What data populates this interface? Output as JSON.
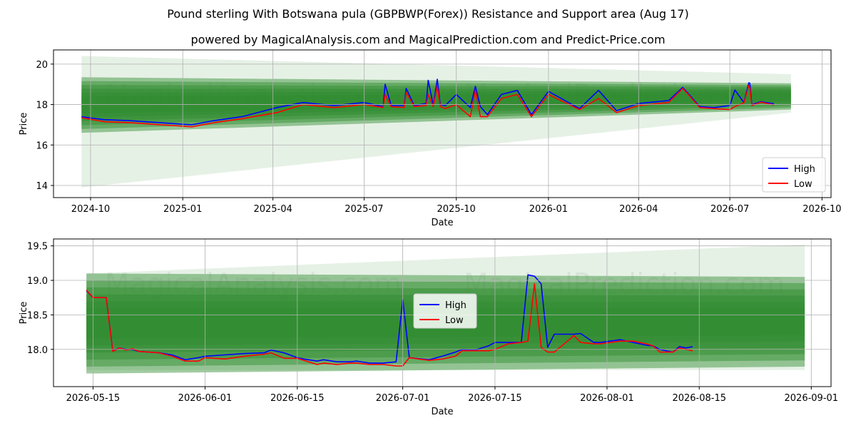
{
  "title": "Pound sterling With Botswana pula (GBPBWP(Forex)) Resistance and Support area (Aug 17)",
  "subtitle": "powered by MagicalAnalysis.com and MagicalPrediction.com and Predict-Price.com",
  "colors": {
    "high": "#0000ff",
    "low": "#ff0000",
    "band": "#2e8b2e",
    "grid": "#b0b0b0"
  },
  "chart_data": [
    {
      "type": "line",
      "xlabel": "Date",
      "ylabel": "Price",
      "xlim": [
        "2024-08-25",
        "2026-10-10"
      ],
      "ylim": [
        13.4,
        20.7
      ],
      "x_ticks": [
        "2024-10",
        "2025-01",
        "2025-04",
        "2025-07",
        "2025-10",
        "2026-01",
        "2026-04",
        "2026-07",
        "2026-10"
      ],
      "x_tick_dates": [
        "2024-10-01",
        "2025-01-01",
        "2025-04-01",
        "2025-07-01",
        "2025-10-01",
        "2026-01-01",
        "2026-04-01",
        "2026-07-01",
        "2026-10-01"
      ],
      "y_ticks": [
        "14",
        "16",
        "18",
        "20"
      ],
      "y_tick_values": [
        14,
        16,
        18,
        20
      ],
      "grid": true,
      "legend": "lower right",
      "watermarks": [
        "MagicalAnalysis.com",
        "MagicalPrediction.com"
      ],
      "resistance_band": {
        "start": "2024-09-22",
        "end": "2026-08-31",
        "top_start": 19.35,
        "top_end": 19.05,
        "bottom_start": 16.6,
        "bottom_end": 17.75
      },
      "prediction_cone": {
        "start": "2024-09-22",
        "end": "2026-08-31",
        "top_start": 20.4,
        "top_end": 19.5,
        "bottom_start": 13.9,
        "bottom_end": 17.6
      },
      "series": [
        {
          "name": "High",
          "x": [
            "2024-09-22",
            "2024-10-15",
            "2024-11-10",
            "2024-12-10",
            "2025-01-10",
            "2025-02-01",
            "2025-03-01",
            "2025-04-05",
            "2025-05-01",
            "2025-06-01",
            "2025-07-01",
            "2025-07-20",
            "2025-07-22",
            "2025-07-28",
            "2025-08-10",
            "2025-08-12",
            "2025-08-20",
            "2025-09-01",
            "2025-09-03",
            "2025-09-08",
            "2025-09-12",
            "2025-09-15",
            "2025-09-20",
            "2025-10-01",
            "2025-10-15",
            "2025-10-20",
            "2025-10-25",
            "2025-11-01",
            "2025-11-15",
            "2025-12-01",
            "2025-12-15",
            "2026-01-01",
            "2026-02-01",
            "2026-02-20",
            "2026-03-10",
            "2026-04-01",
            "2026-05-01",
            "2026-05-15",
            "2026-06-01",
            "2026-06-15",
            "2026-07-01",
            "2026-07-06",
            "2026-07-15",
            "2026-07-20",
            "2026-07-21",
            "2026-07-23",
            "2026-08-01",
            "2026-08-14"
          ],
          "values": [
            17.4,
            17.25,
            17.2,
            17.1,
            17.0,
            17.2,
            17.4,
            17.85,
            18.1,
            17.95,
            18.1,
            17.9,
            19.0,
            17.95,
            17.95,
            18.8,
            17.95,
            18.05,
            19.2,
            17.95,
            19.25,
            18.0,
            17.95,
            18.5,
            17.85,
            18.9,
            17.9,
            17.5,
            18.5,
            18.7,
            17.5,
            18.65,
            17.8,
            18.7,
            17.7,
            18.05,
            18.2,
            18.85,
            17.9,
            17.85,
            17.95,
            18.72,
            18.1,
            19.08,
            19.05,
            18.0,
            18.14,
            18.04
          ]
        },
        {
          "name": "Low",
          "x": [
            "2024-09-22",
            "2024-10-15",
            "2024-11-10",
            "2024-12-10",
            "2025-01-10",
            "2025-02-01",
            "2025-03-01",
            "2025-04-05",
            "2025-05-01",
            "2025-06-01",
            "2025-07-01",
            "2025-07-20",
            "2025-07-22",
            "2025-07-28",
            "2025-08-10",
            "2025-08-12",
            "2025-08-20",
            "2025-09-01",
            "2025-09-03",
            "2025-09-08",
            "2025-09-12",
            "2025-09-15",
            "2025-09-20",
            "2025-10-01",
            "2025-10-15",
            "2025-10-20",
            "2025-10-25",
            "2025-11-01",
            "2025-11-15",
            "2025-12-01",
            "2025-12-15",
            "2026-01-01",
            "2026-02-01",
            "2026-02-20",
            "2026-03-10",
            "2026-04-01",
            "2026-05-01",
            "2026-05-15",
            "2026-06-01",
            "2026-06-15",
            "2026-07-01",
            "2026-07-06",
            "2026-07-15",
            "2026-07-20",
            "2026-07-21",
            "2026-07-23",
            "2026-08-01",
            "2026-08-14"
          ],
          "values": [
            17.35,
            17.15,
            17.1,
            17.0,
            16.9,
            17.1,
            17.3,
            17.6,
            18.0,
            17.85,
            18.0,
            17.85,
            18.5,
            17.9,
            17.85,
            18.6,
            17.9,
            17.95,
            18.5,
            17.9,
            18.9,
            17.9,
            17.8,
            18.0,
            17.4,
            18.7,
            17.4,
            17.4,
            18.3,
            18.5,
            17.4,
            18.5,
            17.75,
            18.3,
            17.6,
            17.95,
            18.1,
            18.8,
            17.85,
            17.8,
            17.75,
            17.9,
            18.08,
            18.95,
            18.8,
            17.95,
            18.12,
            17.98
          ]
        }
      ]
    },
    {
      "type": "line",
      "xlabel": "Date",
      "ylabel": "Price",
      "xlim": [
        "2026-05-09",
        "2026-09-04"
      ],
      "ylim": [
        17.46,
        19.6
      ],
      "x_ticks": [
        "2026-05-15",
        "2026-06-01",
        "2026-06-15",
        "2026-07-01",
        "2026-07-15",
        "2026-08-01",
        "2026-08-15",
        "2026-09-01"
      ],
      "y_ticks": [
        "18.0",
        "18.5",
        "19.0",
        "19.5"
      ],
      "y_tick_values": [
        18.0,
        18.5,
        19.0,
        19.5
      ],
      "grid": true,
      "legend": "center",
      "watermarks": [
        "MagicalAnalysis.com",
        "MagicalPrediction.com"
      ],
      "resistance_band": {
        "start": "2026-05-14",
        "end": "2026-08-31",
        "top_start": 19.1,
        "top_end": 19.05,
        "bottom_start": 17.65,
        "bottom_end": 17.75
      },
      "prediction_cone": {
        "start": "2026-05-14",
        "end": "2026-08-31",
        "top_start": 19.1,
        "top_end": 19.52,
        "bottom_start": 17.7,
        "bottom_end": 17.7
      },
      "series": [
        {
          "name": "High",
          "x": [
            "2026-05-14",
            "2026-05-15",
            "2026-05-17",
            "2026-05-18",
            "2026-05-19",
            "2026-05-20",
            "2026-05-21",
            "2026-05-22",
            "2026-05-25",
            "2026-05-27",
            "2026-05-29",
            "2026-05-31",
            "2026-06-01",
            "2026-06-04",
            "2026-06-07",
            "2026-06-10",
            "2026-06-11",
            "2026-06-13",
            "2026-06-15",
            "2026-06-16",
            "2026-06-18",
            "2026-06-19",
            "2026-06-21",
            "2026-06-23",
            "2026-06-24",
            "2026-06-26",
            "2026-06-28",
            "2026-06-30",
            "2026-07-01",
            "2026-07-02",
            "2026-07-05",
            "2026-07-07",
            "2026-07-09",
            "2026-07-10",
            "2026-07-12",
            "2026-07-14",
            "2026-07-15",
            "2026-07-17",
            "2026-07-19",
            "2026-07-20",
            "2026-07-21",
            "2026-07-22",
            "2026-07-23",
            "2026-07-24",
            "2026-07-27",
            "2026-07-28",
            "2026-07-30",
            "2026-07-31",
            "2026-08-03",
            "2026-08-05",
            "2026-08-07",
            "2026-08-08",
            "2026-08-09",
            "2026-08-11",
            "2026-08-12",
            "2026-08-13",
            "2026-08-14"
          ],
          "values": [
            18.85,
            18.75,
            18.75,
            17.98,
            18.02,
            18.0,
            18.0,
            17.97,
            17.95,
            17.92,
            17.85,
            17.88,
            17.9,
            17.92,
            17.94,
            17.95,
            17.99,
            17.95,
            17.88,
            17.86,
            17.83,
            17.85,
            17.82,
            17.82,
            17.83,
            17.8,
            17.8,
            17.82,
            18.72,
            17.88,
            17.85,
            17.9,
            17.96,
            18.0,
            17.99,
            18.05,
            18.1,
            18.1,
            18.1,
            19.08,
            19.06,
            18.95,
            18.03,
            18.22,
            18.22,
            18.23,
            18.1,
            18.1,
            18.14,
            18.1,
            18.06,
            18.05,
            18.0,
            17.96,
            18.04,
            18.02,
            18.04
          ]
        },
        {
          "name": "Low",
          "x": [
            "2026-05-14",
            "2026-05-15",
            "2026-05-17",
            "2026-05-18",
            "2026-05-19",
            "2026-05-20",
            "2026-05-21",
            "2026-05-22",
            "2026-05-25",
            "2026-05-27",
            "2026-05-29",
            "2026-05-31",
            "2026-06-01",
            "2026-06-04",
            "2026-06-07",
            "2026-06-10",
            "2026-06-11",
            "2026-06-13",
            "2026-06-15",
            "2026-06-16",
            "2026-06-18",
            "2026-06-19",
            "2026-06-21",
            "2026-06-23",
            "2026-06-24",
            "2026-06-26",
            "2026-06-28",
            "2026-06-30",
            "2026-07-01",
            "2026-07-02",
            "2026-07-05",
            "2026-07-07",
            "2026-07-09",
            "2026-07-10",
            "2026-07-12",
            "2026-07-14",
            "2026-07-15",
            "2026-07-17",
            "2026-07-19",
            "2026-07-20",
            "2026-07-21",
            "2026-07-22",
            "2026-07-23",
            "2026-07-24",
            "2026-07-27",
            "2026-07-28",
            "2026-07-30",
            "2026-07-31",
            "2026-08-03",
            "2026-08-05",
            "2026-08-07",
            "2026-08-08",
            "2026-08-09",
            "2026-08-11",
            "2026-08-12",
            "2026-08-13",
            "2026-08-14"
          ],
          "values": [
            18.86,
            18.75,
            18.75,
            17.97,
            18.02,
            17.99,
            18.01,
            17.97,
            17.95,
            17.9,
            17.83,
            17.83,
            17.88,
            17.86,
            17.9,
            17.93,
            17.95,
            17.87,
            17.87,
            17.84,
            17.78,
            17.8,
            17.78,
            17.8,
            17.8,
            17.78,
            17.78,
            17.76,
            17.76,
            17.88,
            17.84,
            17.86,
            17.9,
            17.98,
            17.98,
            17.98,
            18.0,
            18.08,
            18.1,
            18.12,
            18.95,
            18.03,
            17.96,
            17.96,
            18.2,
            18.1,
            18.08,
            18.08,
            18.12,
            18.12,
            18.08,
            18.05,
            17.96,
            17.96,
            18.02,
            18.0,
            17.98
          ]
        }
      ]
    }
  ]
}
